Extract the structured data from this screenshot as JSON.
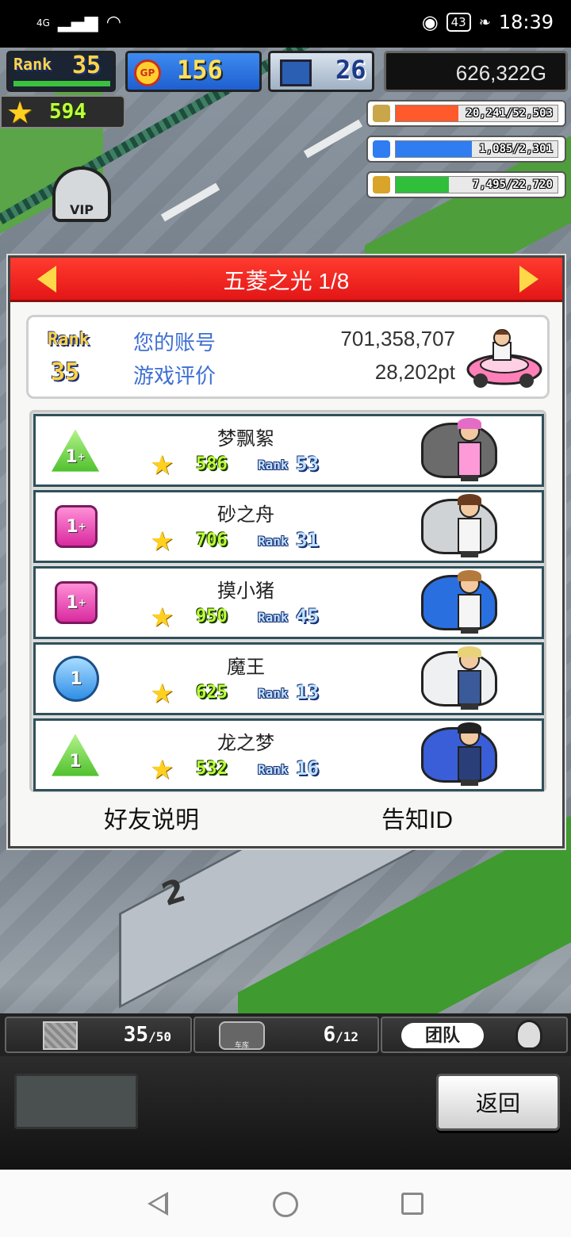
{
  "status_bar": {
    "network": "4G",
    "battery": "43",
    "time": "18:39"
  },
  "hud": {
    "rank_label": "Rank",
    "rank_value": "35",
    "gp_icon": "GP",
    "gp_value": "156",
    "pc_value": "26",
    "money": "626,322G",
    "stars": "594",
    "vip": "VIP",
    "meters": [
      {
        "icon": "coin-stack-icon",
        "text": "20,241/52,503",
        "fill": 0.385,
        "color": "#ff5a2c"
      },
      {
        "icon": "bottle-icon",
        "text": "1,085/2,301",
        "fill": 0.47,
        "color": "#2f7df0"
      },
      {
        "icon": "wheat-icon",
        "text": "7,495/22,720",
        "fill": 0.33,
        "color": "#2fbf3a"
      }
    ]
  },
  "dialog": {
    "title": "五菱之光 1/8",
    "account": {
      "rank_label": "Rank",
      "rank_value": "35",
      "id_label": "您的账号",
      "id_value": "701,358,707",
      "rating_label": "游戏评价",
      "rating_value": "28,202pt"
    },
    "friends": [
      {
        "name": "梦飘絮",
        "badge_shape": "tri",
        "badge": "1",
        "badge_plus": "+",
        "gp": "586",
        "rank_label": "Rank",
        "rank": "53",
        "car_color": "#6b6b6b",
        "hair_color": "#e46cc7",
        "outfit_color": "#ff9ad8"
      },
      {
        "name": "砂之舟",
        "badge_shape": "sq",
        "badge": "1",
        "badge_plus": "+",
        "gp": "706",
        "rank_label": "Rank",
        "rank": "31",
        "car_color": "#cfd3d6",
        "hair_color": "#6b3b1f",
        "outfit_color": "#f5f5f5"
      },
      {
        "name": "摸小猪",
        "badge_shape": "sq",
        "badge": "1",
        "badge_plus": "+",
        "gp": "950",
        "rank_label": "Rank",
        "rank": "45",
        "car_color": "#2a6fe0",
        "hair_color": "#b47a3c",
        "outfit_color": "#f5f5f5"
      },
      {
        "name": "魔王",
        "badge_shape": "circ",
        "badge": "1",
        "badge_plus": "",
        "gp": "625",
        "rank_label": "Rank",
        "rank": "13",
        "car_color": "#eef0f2",
        "hair_color": "#e8d27a",
        "outfit_color": "#3b5a9a"
      },
      {
        "name": "龙之梦",
        "badge_shape": "tri",
        "badge": "1",
        "badge_plus": "",
        "gp": "532",
        "rank_label": "Rank",
        "rank": "16",
        "car_color": "#3a5ed8",
        "hair_color": "#222222",
        "outfit_color": "#2a3f7a"
      }
    ],
    "friend_info_label": "好友说明",
    "notify_id_label": "告知ID"
  },
  "bottom_tabs": {
    "box_count": "35",
    "box_max": "50",
    "garage_label": "车库",
    "garage_count": "6",
    "garage_max": "12",
    "team_label": "团队"
  },
  "back_label": "返回",
  "colors": {
    "header_red": "#e31616",
    "arrow_yellow": "#ffd84a",
    "label_blue": "#3e6fd2",
    "gp_green": "#bfff3a"
  }
}
